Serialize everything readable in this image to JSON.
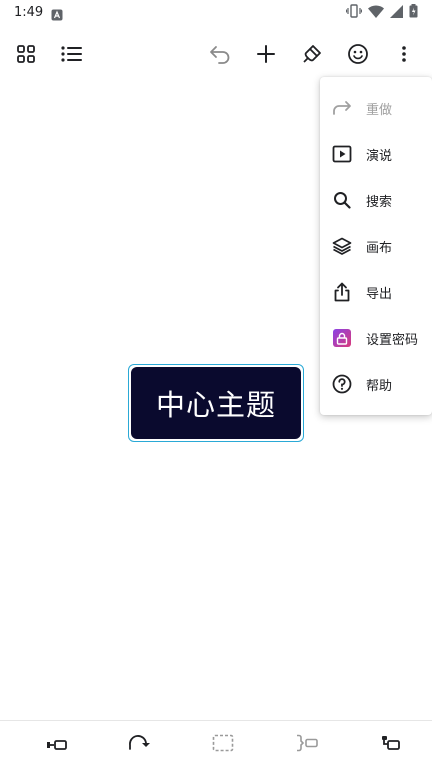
{
  "status_bar": {
    "time": "1:49",
    "icons": [
      "notification-a-icon",
      "vibrate-icon",
      "wifi-icon",
      "signal-icon",
      "battery-icon"
    ]
  },
  "toolbar": {
    "left": [
      "grid-view-icon",
      "outline-list-icon"
    ],
    "right": [
      "undo-icon",
      "add-icon",
      "style-brush-icon",
      "emoji-icon",
      "more-vert-icon"
    ]
  },
  "canvas": {
    "central_topic": "中心主题",
    "topic_color": "#0a0a2e",
    "selection_color": "#2aa9d6"
  },
  "menu": {
    "items": [
      {
        "label": "重做",
        "icon": "redo-icon",
        "enabled": false
      },
      {
        "label": "演说",
        "icon": "presentation-icon",
        "enabled": true
      },
      {
        "label": "搜索",
        "icon": "search-icon",
        "enabled": true
      },
      {
        "label": "画布",
        "icon": "layers-icon",
        "enabled": true
      },
      {
        "label": "导出",
        "icon": "share-export-icon",
        "enabled": true
      },
      {
        "label": "设置密码",
        "icon": "lock-icon",
        "enabled": true
      },
      {
        "label": "帮助",
        "icon": "help-icon",
        "enabled": true
      }
    ]
  },
  "bottom_bar": {
    "tools": [
      "add-sibling-topic-icon",
      "relationship-icon",
      "boundary-icon",
      "summary-icon",
      "add-subtopic-icon"
    ]
  }
}
